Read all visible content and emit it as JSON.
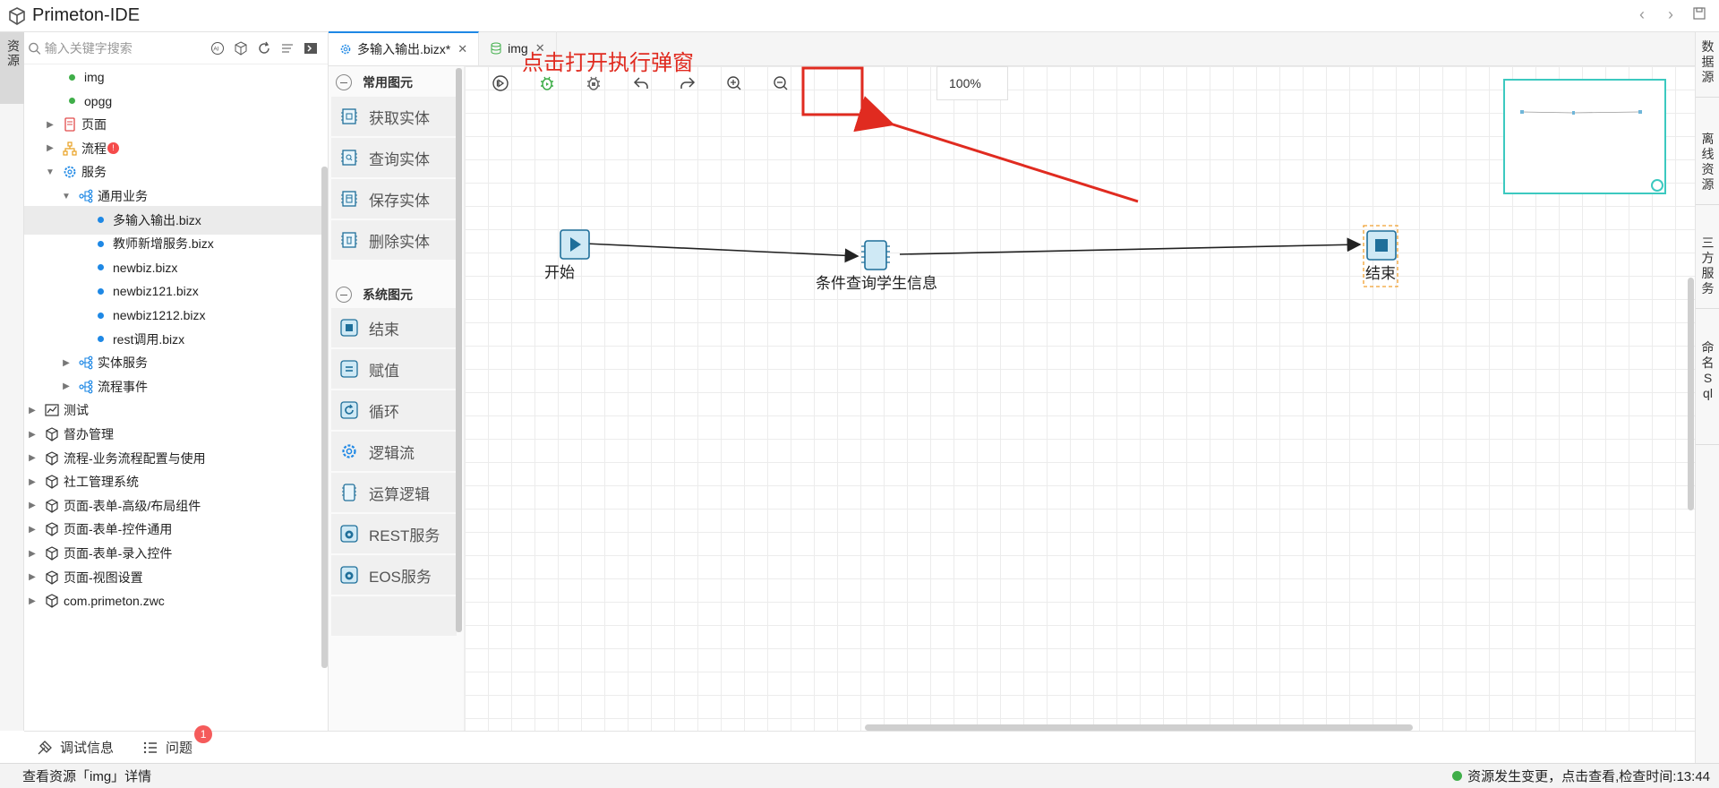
{
  "app": {
    "title": "Primeton-IDE"
  },
  "leftbar": {
    "tab": "资源"
  },
  "explorer": {
    "search_placeholder": "输入关键字搜索",
    "tools": [
      "AI",
      "□",
      "↻",
      "☰",
      "⇆"
    ],
    "items": [
      {
        "label": "img",
        "kind": "dot-green"
      },
      {
        "label": "opgg",
        "kind": "dot-green"
      },
      {
        "label": "页面",
        "kind": "folder-page"
      },
      {
        "label": "流程",
        "kind": "folder-flow",
        "badge": "!"
      },
      {
        "label": "服务",
        "kind": "folder-service"
      },
      {
        "label": "通用业务",
        "kind": "folder-biz"
      },
      {
        "label": "多输入输出.bizx",
        "kind": "dot-blue",
        "selected": true
      },
      {
        "label": "教师新增服务.bizx",
        "kind": "dot-blue"
      },
      {
        "label": "newbiz.bizx",
        "kind": "dot-blue"
      },
      {
        "label": "newbiz121.bizx",
        "kind": "dot-blue"
      },
      {
        "label": "newbiz1212.bizx",
        "kind": "dot-blue"
      },
      {
        "label": "rest调用.bizx",
        "kind": "dot-blue"
      },
      {
        "label": "实体服务",
        "kind": "folder-biz"
      },
      {
        "label": "流程事件",
        "kind": "folder-biz"
      },
      {
        "label": "测试",
        "kind": "project-chart"
      },
      {
        "label": "督办管理",
        "kind": "project"
      },
      {
        "label": "流程-业务流程配置与使用",
        "kind": "project"
      },
      {
        "label": "社工管理系统",
        "kind": "project"
      },
      {
        "label": "页面-表单-高级/布局组件",
        "kind": "project"
      },
      {
        "label": "页面-表单-控件通用",
        "kind": "project"
      },
      {
        "label": "页面-表单-录入控件",
        "kind": "project"
      },
      {
        "label": "页面-视图设置",
        "kind": "project"
      },
      {
        "label": "com.primeton.zwc",
        "kind": "project"
      }
    ]
  },
  "editor": {
    "tabs": [
      {
        "label": "多输入输出.bizx*",
        "active": true
      },
      {
        "label": "img",
        "active": false
      }
    ],
    "zoom": "100%",
    "hint": "点击打开执行弹窗"
  },
  "palette": {
    "groups": [
      {
        "label": "常用图元",
        "items": [
          "获取实体",
          "查询实体",
          "保存实体",
          "删除实体"
        ]
      },
      {
        "label": "系统图元",
        "items": [
          "结束",
          "赋值",
          "循环",
          "逻辑流",
          "运算逻辑",
          "REST服务",
          "EOS服务"
        ]
      }
    ]
  },
  "flow": {
    "nodes": [
      {
        "id": "start",
        "label": "开始"
      },
      {
        "id": "query",
        "label": "条件查询学生信息"
      },
      {
        "id": "end",
        "label": "结束"
      }
    ]
  },
  "rightbar": {
    "tabs": [
      "数据源",
      "离线资源",
      "三方服务",
      "命名Sql"
    ]
  },
  "bottom": {
    "debug": "调试信息",
    "problems": "问题",
    "problem_count": "1"
  },
  "status": {
    "left": "查看资源「img」详情",
    "right": "资源发生变更，点击查看,检查时间:13:44"
  },
  "colors": {
    "accent": "#1e88e5",
    "hint": "#e02b20",
    "minimap": "#3cc9c0",
    "ok": "#3fae49"
  }
}
